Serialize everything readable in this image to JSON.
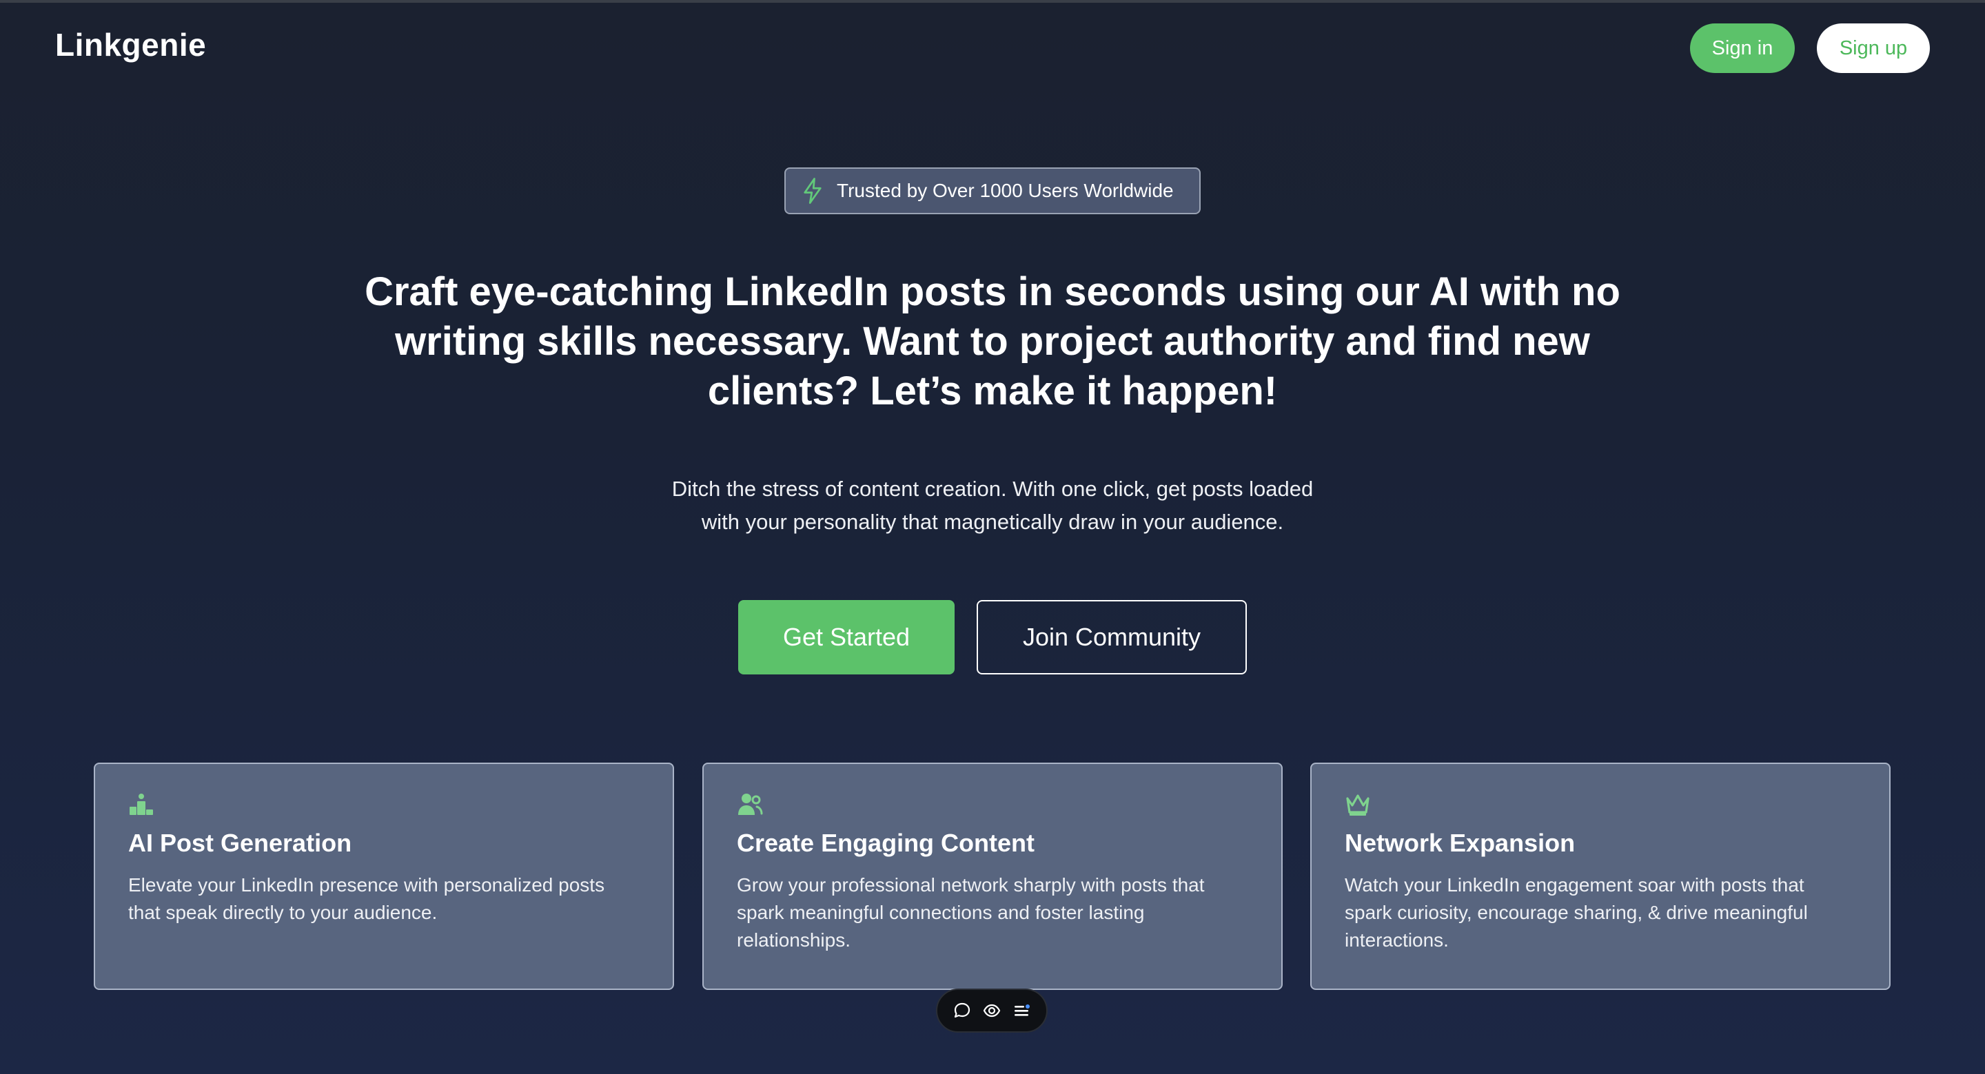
{
  "header": {
    "logo": "Linkgenie",
    "signin_label": "Sign in",
    "signup_label": "Sign up"
  },
  "badge": {
    "text": "Trusted by Over 1000 Users Worldwide",
    "icon": "lightning-icon"
  },
  "hero": {
    "headline": "Craft eye-catching LinkedIn posts in seconds using our AI with no writing skills necessary. Want to project authority and find new clients? Let’s make it happen!",
    "subtext": "Ditch the stress of content creation. With one click, get posts loaded with your personality that magnetically draw in your audience.",
    "primary_cta": "Get Started",
    "secondary_cta": "Join Community"
  },
  "features": [
    {
      "icon": "podium-icon",
      "title": "AI Post Generation",
      "description": "Elevate your LinkedIn presence with personalized posts that speak directly to your audience."
    },
    {
      "icon": "users-icon",
      "title": "Create Engaging Content",
      "description": "Grow your professional network sharply with posts that spark meaningful connections and foster lasting relationships."
    },
    {
      "icon": "crown-icon",
      "title": "Network Expansion",
      "description": "Watch your LinkedIn engagement soar with posts that spark curiosity, encourage sharing, & drive meaningful interactions."
    }
  ],
  "toolbar": {
    "items": [
      "comment-icon",
      "eye-icon",
      "menu-icon"
    ]
  },
  "colors": {
    "accent_green": "#5cc26a",
    "background": "#1a2236",
    "card_background": "#58657f",
    "badge_background": "#4b5670"
  }
}
